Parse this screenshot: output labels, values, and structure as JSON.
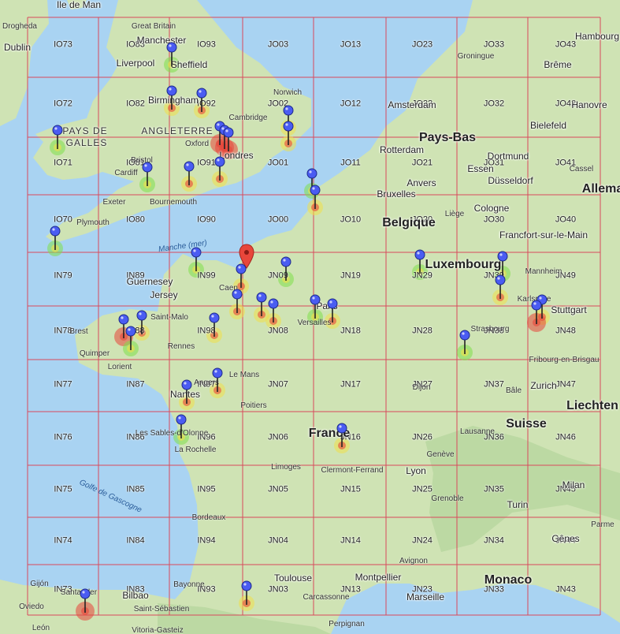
{
  "map": {
    "colors": {
      "sea": "#a9d3f2",
      "land": "#cfe3b4",
      "grid_line": "#d94a5c",
      "marker_blue": "#4a5cf2",
      "marker_red": "#e8463b",
      "heat_green": "#7fe04a",
      "heat_yellow": "#f0e04a",
      "heat_red": "#e8463b"
    },
    "grid_labels": [
      {
        "text": "IO73",
        "col": 0,
        "row": 0
      },
      {
        "text": "IO83",
        "col": 1,
        "row": 0
      },
      {
        "text": "IO93",
        "col": 2,
        "row": 0
      },
      {
        "text": "JO03",
        "col": 3,
        "row": 0
      },
      {
        "text": "JO13",
        "col": 4,
        "row": 0
      },
      {
        "text": "JO23",
        "col": 5,
        "row": 0
      },
      {
        "text": "JO33",
        "col": 6,
        "row": 0
      },
      {
        "text": "JO43",
        "col": 7,
        "row": 0
      },
      {
        "text": "IO72",
        "col": 0,
        "row": 1
      },
      {
        "text": "IO82",
        "col": 1,
        "row": 1
      },
      {
        "text": "IO92",
        "col": 2,
        "row": 1
      },
      {
        "text": "JO02",
        "col": 3,
        "row": 1
      },
      {
        "text": "JO12",
        "col": 4,
        "row": 1
      },
      {
        "text": "JO22",
        "col": 5,
        "row": 1
      },
      {
        "text": "JO32",
        "col": 6,
        "row": 1
      },
      {
        "text": "JO42",
        "col": 7,
        "row": 1
      },
      {
        "text": "IO71",
        "col": 0,
        "row": 2
      },
      {
        "text": "IO81",
        "col": 1,
        "row": 2
      },
      {
        "text": "IO91",
        "col": 2,
        "row": 2
      },
      {
        "text": "JO01",
        "col": 3,
        "row": 2
      },
      {
        "text": "JO11",
        "col": 4,
        "row": 2
      },
      {
        "text": "JO21",
        "col": 5,
        "row": 2
      },
      {
        "text": "JO31",
        "col": 6,
        "row": 2
      },
      {
        "text": "JO41",
        "col": 7,
        "row": 2
      },
      {
        "text": "IO70",
        "col": 0,
        "row": 3
      },
      {
        "text": "IO80",
        "col": 1,
        "row": 3
      },
      {
        "text": "IO90",
        "col": 2,
        "row": 3
      },
      {
        "text": "JO00",
        "col": 3,
        "row": 3
      },
      {
        "text": "JO10",
        "col": 4,
        "row": 3
      },
      {
        "text": "JO20",
        "col": 5,
        "row": 3
      },
      {
        "text": "JO30",
        "col": 6,
        "row": 3
      },
      {
        "text": "JO40",
        "col": 7,
        "row": 3
      },
      {
        "text": "IN79",
        "col": 0,
        "row": 4
      },
      {
        "text": "IN89",
        "col": 1,
        "row": 4
      },
      {
        "text": "IN99",
        "col": 2,
        "row": 4
      },
      {
        "text": "JN09",
        "col": 3,
        "row": 4
      },
      {
        "text": "JN19",
        "col": 4,
        "row": 4
      },
      {
        "text": "JN29",
        "col": 5,
        "row": 4
      },
      {
        "text": "JN39",
        "col": 6,
        "row": 4
      },
      {
        "text": "JN49",
        "col": 7,
        "row": 4
      },
      {
        "text": "IN78",
        "col": 0,
        "row": 5
      },
      {
        "text": "IN88",
        "col": 1,
        "row": 5
      },
      {
        "text": "IN98",
        "col": 2,
        "row": 5
      },
      {
        "text": "JN08",
        "col": 3,
        "row": 5
      },
      {
        "text": "JN18",
        "col": 4,
        "row": 5
      },
      {
        "text": "JN28",
        "col": 5,
        "row": 5
      },
      {
        "text": "JN38",
        "col": 6,
        "row": 5
      },
      {
        "text": "JN48",
        "col": 7,
        "row": 5
      },
      {
        "text": "IN77",
        "col": 0,
        "row": 6
      },
      {
        "text": "IN87",
        "col": 1,
        "row": 6
      },
      {
        "text": "IN97",
        "col": 2,
        "row": 6
      },
      {
        "text": "JN07",
        "col": 3,
        "row": 6
      },
      {
        "text": "JN17",
        "col": 4,
        "row": 6
      },
      {
        "text": "JN27",
        "col": 5,
        "row": 6
      },
      {
        "text": "JN37",
        "col": 6,
        "row": 6
      },
      {
        "text": "JN47",
        "col": 7,
        "row": 6
      },
      {
        "text": "IN76",
        "col": 0,
        "row": 7
      },
      {
        "text": "IN86",
        "col": 1,
        "row": 7
      },
      {
        "text": "IN96",
        "col": 2,
        "row": 7
      },
      {
        "text": "JN06",
        "col": 3,
        "row": 7
      },
      {
        "text": "JN16",
        "col": 4,
        "row": 7
      },
      {
        "text": "JN26",
        "col": 5,
        "row": 7
      },
      {
        "text": "JN36",
        "col": 6,
        "row": 7
      },
      {
        "text": "JN46",
        "col": 7,
        "row": 7
      },
      {
        "text": "IN75",
        "col": 0,
        "row": 8
      },
      {
        "text": "IN85",
        "col": 1,
        "row": 8
      },
      {
        "text": "IN95",
        "col": 2,
        "row": 8
      },
      {
        "text": "JN05",
        "col": 3,
        "row": 8
      },
      {
        "text": "JN15",
        "col": 4,
        "row": 8
      },
      {
        "text": "JN25",
        "col": 5,
        "row": 8
      },
      {
        "text": "JN35",
        "col": 6,
        "row": 8
      },
      {
        "text": "JN45",
        "col": 7,
        "row": 8
      },
      {
        "text": "IN74",
        "col": 0,
        "row": 9
      },
      {
        "text": "IN84",
        "col": 1,
        "row": 9
      },
      {
        "text": "IN94",
        "col": 2,
        "row": 9
      },
      {
        "text": "JN04",
        "col": 3,
        "row": 9
      },
      {
        "text": "JN14",
        "col": 4,
        "row": 9
      },
      {
        "text": "JN24",
        "col": 5,
        "row": 9
      },
      {
        "text": "JN34",
        "col": 6,
        "row": 9
      },
      {
        "text": "JN44",
        "col": 7,
        "row": 9
      },
      {
        "text": "IN73",
        "col": 0,
        "row": 10
      },
      {
        "text": "IN83",
        "col": 1,
        "row": 10
      },
      {
        "text": "IN93",
        "col": 2,
        "row": 10
      },
      {
        "text": "JN03",
        "col": 3,
        "row": 10
      },
      {
        "text": "JN13",
        "col": 4,
        "row": 10
      },
      {
        "text": "JN23",
        "col": 5,
        "row": 10
      },
      {
        "text": "JN33",
        "col": 6,
        "row": 10
      },
      {
        "text": "JN43",
        "col": 7,
        "row": 10
      }
    ],
    "place_labels": [
      {
        "text": "Ile de Man",
        "kind": "city"
      },
      {
        "text": "Drogheda",
        "kind": "small"
      },
      {
        "text": "Dublin",
        "kind": "city"
      },
      {
        "text": "Great Britain",
        "kind": "small"
      },
      {
        "text": "Manchester",
        "kind": "city"
      },
      {
        "text": "Liverpool",
        "kind": "city"
      },
      {
        "text": "Sheffield",
        "kind": "city"
      },
      {
        "text": "Birmingham",
        "kind": "city"
      },
      {
        "text": "Norwich",
        "kind": "small"
      },
      {
        "text": "Cambridge",
        "kind": "small"
      },
      {
        "text": "PAYS DE",
        "kind": "region"
      },
      {
        "text": "GALLES",
        "kind": "region"
      },
      {
        "text": "ANGLETERRE",
        "kind": "region"
      },
      {
        "text": "Oxford",
        "kind": "small"
      },
      {
        "text": "Londres",
        "kind": "city"
      },
      {
        "text": "Bristol",
        "kind": "small"
      },
      {
        "text": "Cardiff",
        "kind": "small"
      },
      {
        "text": "Exeter",
        "kind": "small"
      },
      {
        "text": "Bournemouth",
        "kind": "small"
      },
      {
        "text": "Plymouth",
        "kind": "small"
      },
      {
        "text": "Manche (mer)",
        "kind": "sea"
      },
      {
        "text": "Guernesey",
        "kind": "city"
      },
      {
        "text": "Jersey",
        "kind": "city"
      },
      {
        "text": "Caen",
        "kind": "small"
      },
      {
        "text": "Saint-Malo",
        "kind": "small"
      },
      {
        "text": "Brest",
        "kind": "small"
      },
      {
        "text": "Quimper",
        "kind": "small"
      },
      {
        "text": "Lorient",
        "kind": "small"
      },
      {
        "text": "Rennes",
        "kind": "small"
      },
      {
        "text": "Le Mans",
        "kind": "small"
      },
      {
        "text": "Angers",
        "kind": "small"
      },
      {
        "text": "Nantes",
        "kind": "city"
      },
      {
        "text": "Les Sables-d'Olonne",
        "kind": "small"
      },
      {
        "text": "La Rochelle",
        "kind": "small"
      },
      {
        "text": "Golfe de Gascogne",
        "kind": "sea"
      },
      {
        "text": "Poitiers",
        "kind": "small"
      },
      {
        "text": "Limoges",
        "kind": "small"
      },
      {
        "text": "Bordeaux",
        "kind": "small"
      },
      {
        "text": "Bayonne",
        "kind": "small"
      },
      {
        "text": "Bilbao",
        "kind": "city"
      },
      {
        "text": "Santander",
        "kind": "small"
      },
      {
        "text": "Gijón",
        "kind": "small"
      },
      {
        "text": "Oviedo",
        "kind": "small"
      },
      {
        "text": "León",
        "kind": "small"
      },
      {
        "text": "Saint-Sébastien",
        "kind": "small"
      },
      {
        "text": "Vitoria-Gasteiz",
        "kind": "small"
      },
      {
        "text": "Toulouse",
        "kind": "city"
      },
      {
        "text": "Montpellier",
        "kind": "city"
      },
      {
        "text": "Carcassonne",
        "kind": "small"
      },
      {
        "text": "Perpignan",
        "kind": "small"
      },
      {
        "text": "Marseille",
        "kind": "city"
      },
      {
        "text": "Avignon",
        "kind": "small"
      },
      {
        "text": "Clermont-Ferrand",
        "kind": "small"
      },
      {
        "text": "Lyon",
        "kind": "city"
      },
      {
        "text": "Grenoble",
        "kind": "small"
      },
      {
        "text": "Genève",
        "kind": "small"
      },
      {
        "text": "Lausanne",
        "kind": "small"
      },
      {
        "text": "Dijon",
        "kind": "small"
      },
      {
        "text": "France",
        "kind": "country"
      },
      {
        "text": "Paris",
        "kind": "city"
      },
      {
        "text": "Versailles",
        "kind": "small"
      },
      {
        "text": "Amsterdam",
        "kind": "city"
      },
      {
        "text": "Rotterdam",
        "kind": "city"
      },
      {
        "text": "Pays-Bas",
        "kind": "country"
      },
      {
        "text": "Groningue",
        "kind": "small"
      },
      {
        "text": "Anvers",
        "kind": "city"
      },
      {
        "text": "Bruxelles",
        "kind": "city"
      },
      {
        "text": "Belgique",
        "kind": "country"
      },
      {
        "text": "Liège",
        "kind": "small"
      },
      {
        "text": "Luxembourg",
        "kind": "country"
      },
      {
        "text": "Hambourg",
        "kind": "city"
      },
      {
        "text": "Brême",
        "kind": "city"
      },
      {
        "text": "Hanovre",
        "kind": "city"
      },
      {
        "text": "Bielefeld",
        "kind": "city"
      },
      {
        "text": "Dortmund",
        "kind": "city"
      },
      {
        "text": "Essen",
        "kind": "city"
      },
      {
        "text": "Düsseldorf",
        "kind": "city"
      },
      {
        "text": "Cologne",
        "kind": "city"
      },
      {
        "text": "Cassel",
        "kind": "small"
      },
      {
        "text": "Allema",
        "kind": "country"
      },
      {
        "text": "Francfort-sur-le-Main",
        "kind": "city"
      },
      {
        "text": "Mannheim",
        "kind": "small"
      },
      {
        "text": "Karlsruhe",
        "kind": "small"
      },
      {
        "text": "Stuttgart",
        "kind": "city"
      },
      {
        "text": "Strasbourg",
        "kind": "small"
      },
      {
        "text": "Fribourg-en-Brisgau",
        "kind": "small"
      },
      {
        "text": "Bâle",
        "kind": "small"
      },
      {
        "text": "Zurich",
        "kind": "city"
      },
      {
        "text": "Suisse",
        "kind": "country"
      },
      {
        "text": "Liechten",
        "kind": "country"
      },
      {
        "text": "Milan",
        "kind": "city"
      },
      {
        "text": "Turin",
        "kind": "city"
      },
      {
        "text": "Gênes",
        "kind": "city"
      },
      {
        "text": "Parme",
        "kind": "small"
      },
      {
        "text": "Monaco",
        "kind": "country"
      }
    ],
    "markers": [
      {
        "color": "blue",
        "heat": "green"
      },
      {
        "color": "blue",
        "heat": "green"
      },
      {
        "color": "blue",
        "heat": "yellow"
      },
      {
        "color": "blue",
        "heat": "yellow"
      },
      {
        "color": "blue",
        "heat": "red"
      },
      {
        "color": "blue",
        "heat": "red"
      },
      {
        "color": "blue",
        "heat": "red"
      },
      {
        "color": "blue",
        "heat": "yellow"
      },
      {
        "color": "blue",
        "heat": "yellow"
      },
      {
        "color": "blue",
        "heat": "green"
      },
      {
        "color": "blue",
        "heat": "yellow"
      },
      {
        "color": "blue",
        "heat": "yellow"
      },
      {
        "color": "blue",
        "heat": "green"
      },
      {
        "color": "blue",
        "heat": "yellow"
      },
      {
        "color": "blue",
        "heat": "green"
      },
      {
        "color": "blue",
        "heat": "green"
      },
      {
        "color": "red",
        "heat": "none"
      },
      {
        "color": "blue",
        "heat": "yellow"
      },
      {
        "color": "blue",
        "heat": "green"
      },
      {
        "color": "blue",
        "heat": "yellow"
      },
      {
        "color": "blue",
        "heat": "yellow"
      },
      {
        "color": "blue",
        "heat": "yellow"
      },
      {
        "color": "blue",
        "heat": "green"
      },
      {
        "color": "blue",
        "heat": "yellow"
      },
      {
        "color": "blue",
        "heat": "yellow"
      },
      {
        "color": "blue",
        "heat": "red"
      },
      {
        "color": "blue",
        "heat": "yellow"
      },
      {
        "color": "blue",
        "heat": "green"
      },
      {
        "color": "blue",
        "heat": "yellow"
      },
      {
        "color": "blue",
        "heat": "yellow"
      },
      {
        "color": "blue",
        "heat": "green"
      },
      {
        "color": "blue",
        "heat": "yellow"
      },
      {
        "color": "blue",
        "heat": "green"
      },
      {
        "color": "blue",
        "heat": "green"
      },
      {
        "color": "blue",
        "heat": "yellow"
      },
      {
        "color": "blue",
        "heat": "green"
      },
      {
        "color": "blue",
        "heat": "yellow"
      },
      {
        "color": "blue",
        "heat": "red"
      },
      {
        "color": "blue",
        "heat": "red"
      },
      {
        "color": "blue",
        "heat": "yellow"
      },
      {
        "color": "blue",
        "heat": "yellow"
      },
      {
        "color": "blue",
        "heat": "yellow"
      }
    ]
  }
}
